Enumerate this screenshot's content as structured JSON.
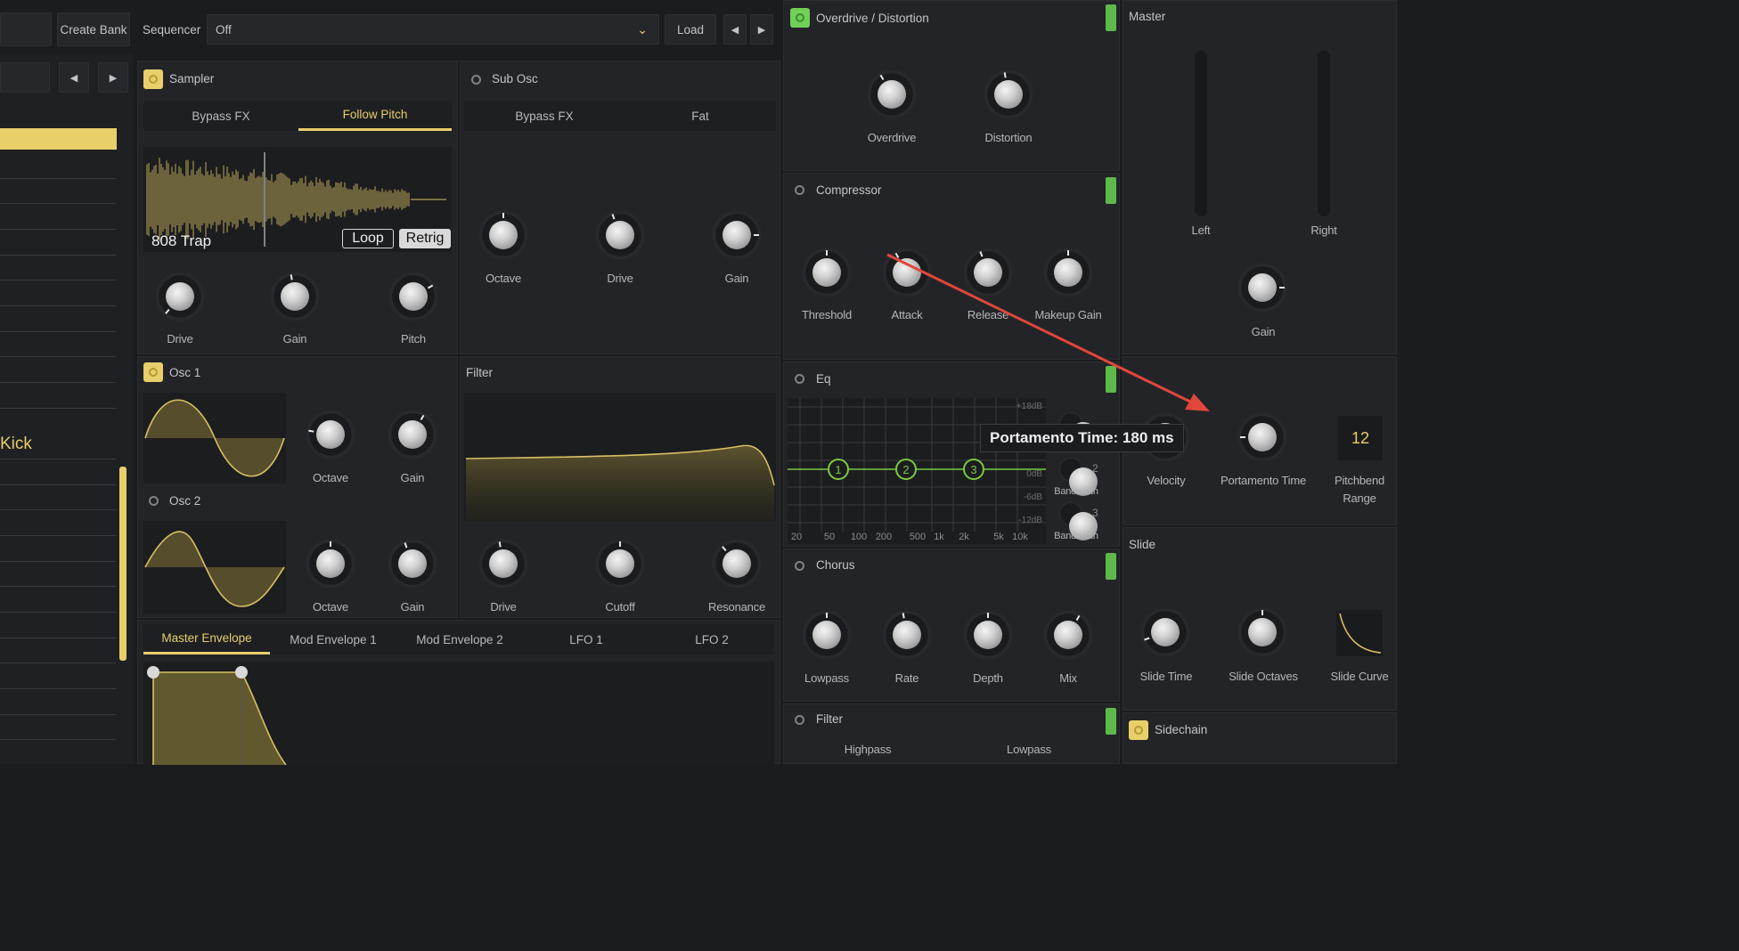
{
  "topbar": {
    "create_bank": "Create Bank",
    "sequencer_label": "Sequencer",
    "sequencer_value": "Off",
    "load": "Load"
  },
  "left": {
    "kick_label": "Kick"
  },
  "sampler": {
    "title": "Sampler",
    "tab_bypass": "Bypass FX",
    "tab_follow": "Follow Pitch",
    "sample_name": "808 Trap",
    "loop": "Loop",
    "retrig": "Retrig",
    "knobs": [
      "Drive",
      "Gain",
      "Pitch"
    ]
  },
  "subosc": {
    "title": "Sub Osc",
    "tab_bypass": "Bypass FX",
    "tab_fat": "Fat",
    "knobs": [
      "Octave",
      "Drive",
      "Gain"
    ]
  },
  "osc1": {
    "title": "Osc 1",
    "knobs": [
      "Octave",
      "Gain"
    ]
  },
  "osc2": {
    "title": "Osc 2",
    "knobs": [
      "Octave",
      "Gain"
    ]
  },
  "filter": {
    "title": "Filter",
    "knobs": [
      "Drive",
      "Cutoff",
      "Resonance"
    ]
  },
  "envtabs": [
    "Master Envelope",
    "Mod Envelope 1",
    "Mod Envelope 2",
    "LFO 1",
    "LFO 2"
  ],
  "overdrive": {
    "title": "Overdrive / Distortion",
    "knobs": [
      "Overdrive",
      "Distortion"
    ]
  },
  "compressor": {
    "title": "Compressor",
    "knobs": [
      "Threshold",
      "Attack",
      "Release",
      "Makeup Gain"
    ]
  },
  "eq": {
    "title": "Eq",
    "db_labels": [
      "+18dB",
      "0dB",
      "-6dB",
      "-12dB"
    ],
    "freq_labels": [
      "20",
      "50",
      "100",
      "200",
      "500",
      "1k",
      "2k",
      "5k",
      "10k"
    ],
    "points": [
      "1",
      "2",
      "3"
    ],
    "side_nums": [
      "1",
      "2",
      "3"
    ],
    "bandwidth": "Bandwidth"
  },
  "chorus": {
    "title": "Chorus",
    "knobs": [
      "Lowpass",
      "Rate",
      "Depth",
      "Mix"
    ]
  },
  "filter2": {
    "title": "Filter",
    "highpass": "Highpass",
    "lowpass": "Lowpass"
  },
  "master": {
    "title": "Master",
    "left": "Left",
    "right": "Right",
    "gain": "Gain"
  },
  "voice": {
    "velocity": "Velocity",
    "portamento": "Portamento Time",
    "pitchbend_value": "12",
    "pitchbend_line1": "Pitchbend",
    "pitchbend_line2": "Range",
    "tooltip": "Portamento Time: 180 ms"
  },
  "slide": {
    "title": "Slide",
    "knobs": [
      "Slide Time",
      "Slide Octaves",
      "Slide Curve"
    ]
  },
  "sidechain": {
    "title": "Sidechain"
  },
  "colors": {
    "accent": "#e7cd69",
    "green": "#6fcf57",
    "arrow": "#e0473a"
  }
}
